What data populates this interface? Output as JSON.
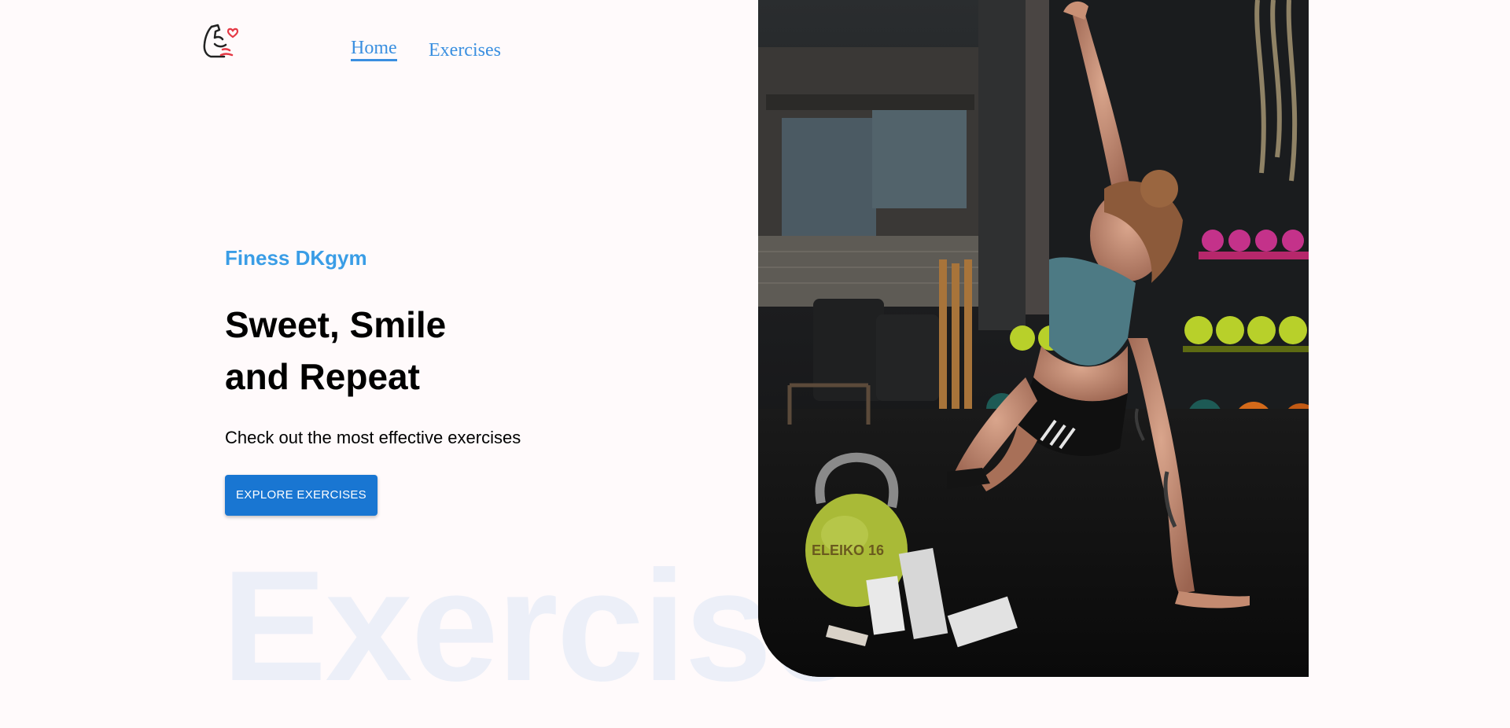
{
  "nav": {
    "logo_icon": "flexed-arm-heart-icon",
    "links": [
      {
        "label": "Home",
        "active": true
      },
      {
        "label": "Exercises",
        "active": false
      }
    ]
  },
  "hero": {
    "tagline": "Finess DKgym",
    "headline_line1": "Sweet, Smile",
    "headline_line2": "and Repeat",
    "subtitle": "Check out the most effective exercises",
    "cta_label": "EXPLORE EXERCISES"
  },
  "watermark": "Exercise",
  "hero_image": {
    "kettlebell_text": "ELEIKO 16"
  },
  "colors": {
    "accent": "#3a9de6",
    "button": "#1976d2",
    "background": "#fffafb"
  }
}
